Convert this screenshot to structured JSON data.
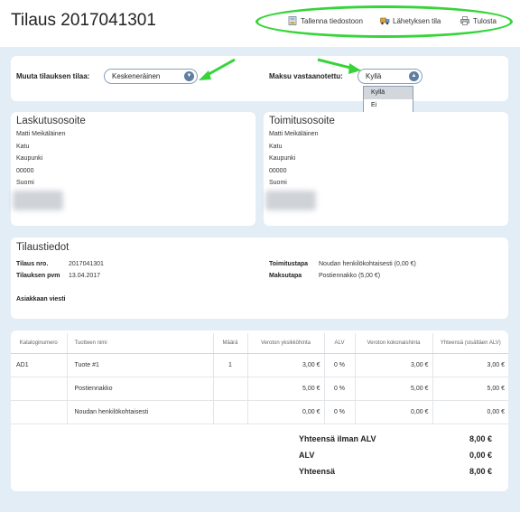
{
  "header": {
    "title": "Tilaus 2017041301",
    "toolbar": {
      "save_label": "Tallenna tiedostoon",
      "shipping_label": "Lähetyksen tila",
      "print_label": "Tulosta"
    }
  },
  "status": {
    "order_status_label": "Muuta tilauksen tilaa:",
    "order_status_value": "Keskeneräinen",
    "payment_received_label": "Maksu vastaanotettu:",
    "payment_received_value": "Kyllä",
    "payment_options": [
      "Kyllä",
      "Ei"
    ]
  },
  "billing": {
    "title": "Laskutusosoite",
    "lines": [
      "Matti Meikäläinen",
      "Katu",
      "Kaupunki",
      "00000",
      "Suomi"
    ]
  },
  "shipping": {
    "title": "Toimitusosoite",
    "lines": [
      "Matti Meikäläinen",
      "Katu",
      "Kaupunki",
      "00000",
      "Suomi"
    ]
  },
  "order_info": {
    "title": "Tilaustiedot",
    "order_no_label": "Tilaus nro.",
    "order_no_value": "2017041301",
    "order_date_label": "Tilauksen pvm",
    "order_date_value": "13.04.2017",
    "delivery_label": "Toimitustapa",
    "delivery_value": "Noudan henkilökohtaisesti (0,00 €)",
    "payment_label": "Maksutapa",
    "payment_value": "Postiennakko (5,00 €)",
    "customer_message_label": "Asiakkaan viesti"
  },
  "items_table": {
    "headers": [
      "Kataloginumero",
      "Tuotteen nimi",
      "Määrä",
      "Veroton yksikköhinta",
      "ALV",
      "Veroton kokonaishinta",
      "Yhteensä (sisältäen ALV)"
    ],
    "rows": [
      [
        "AD1",
        "Tuote #1",
        "1",
        "3,00 €",
        "0 %",
        "3,00 €",
        "3,00 €"
      ],
      [
        "",
        "Postiennakko",
        "",
        "5,00 €",
        "0 %",
        "5,00 €",
        "5,00 €"
      ],
      [
        "",
        "Noudan henkilökohtaisesti",
        "",
        "0,00 €",
        "0 %",
        "0,00 €",
        "0,00 €"
      ]
    ]
  },
  "totals": {
    "subtotal_label": "Yhteensä ilman ALV",
    "subtotal_value": "8,00 €",
    "vat_label": "ALV",
    "vat_value": "0,00 €",
    "total_label": "Yhteensä",
    "total_value": "8,00 €"
  },
  "colors": {
    "highlight": "#36d43a",
    "background": "#e3edf6",
    "select_caret": "#5f7ea3"
  }
}
